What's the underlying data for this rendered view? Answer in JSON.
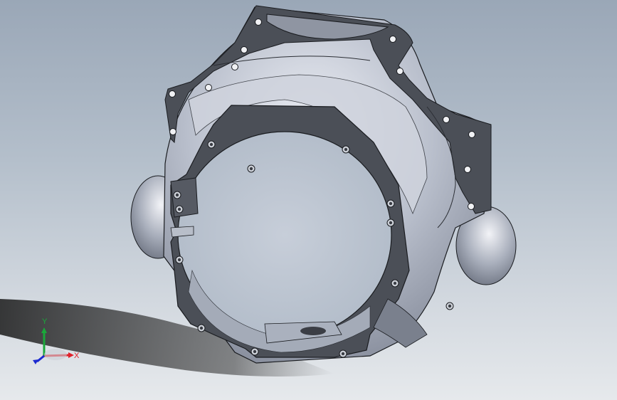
{
  "viewport": {
    "model": "bellhousing-part",
    "background_top": "#9aa7b7",
    "background_bottom": "#e6e9ec"
  },
  "part": {
    "face_color": "#4b4f57",
    "body_color": "#b7bcc8",
    "body_shade": "#8e94a3",
    "edge_color": "#1a1c20"
  },
  "triad": {
    "x_label": "X",
    "y_label": "Y",
    "x_color": "#e0202a",
    "y_color": "#1aa83a",
    "z_color": "#1c2ad0"
  }
}
